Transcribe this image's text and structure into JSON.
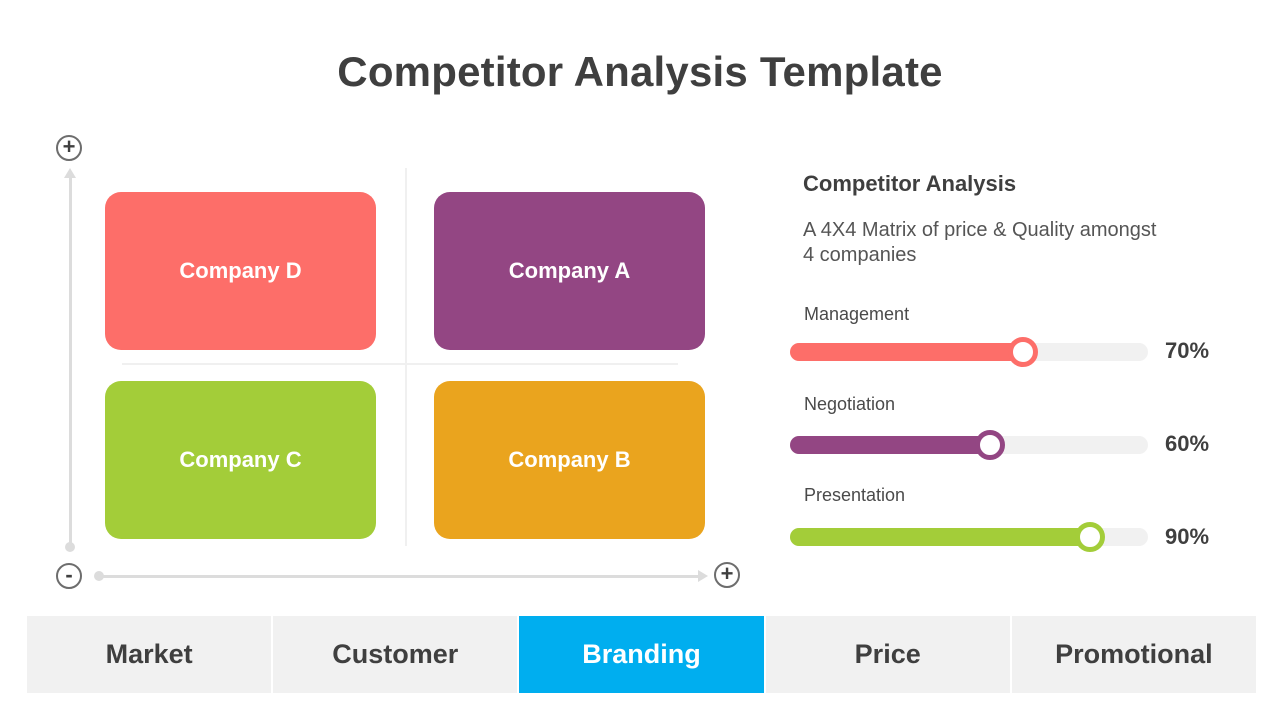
{
  "title": "Competitor Analysis Template",
  "matrix": {
    "axis_controls": {
      "top": "+",
      "bottom_left": "-",
      "right": "+"
    },
    "companies": [
      {
        "label": "Company D",
        "color": "#fd6e69",
        "quadrant": "top-left"
      },
      {
        "label": "Company A",
        "color": "#934683",
        "quadrant": "top-right"
      },
      {
        "label": "Company C",
        "color": "#a3cd39",
        "quadrant": "bottom-left"
      },
      {
        "label": "Company B",
        "color": "#eaa41e",
        "quadrant": "bottom-right"
      }
    ]
  },
  "panel": {
    "heading": "Competitor Analysis",
    "description": "A 4X4 Matrix of price & Quality amongst  4 companies",
    "bars": [
      {
        "label": "Management",
        "value": 70,
        "value_label": "70%",
        "color": "#fd6e69"
      },
      {
        "label": "Negotiation",
        "value": 60,
        "value_label": "60%",
        "color": "#934683"
      },
      {
        "label": "Presentation",
        "value": 90,
        "value_label": "90%",
        "color": "#a3cd39"
      }
    ]
  },
  "tabs": [
    {
      "label": "Market",
      "active": false
    },
    {
      "label": "Customer",
      "active": false
    },
    {
      "label": "Branding",
      "active": true
    },
    {
      "label": "Price",
      "active": false
    },
    {
      "label": "Promotional",
      "active": false
    }
  ],
  "colors": {
    "active_tab": "#00aeef",
    "tab_bg": "#f1f1f1",
    "text_dark": "#3f3f3f"
  }
}
